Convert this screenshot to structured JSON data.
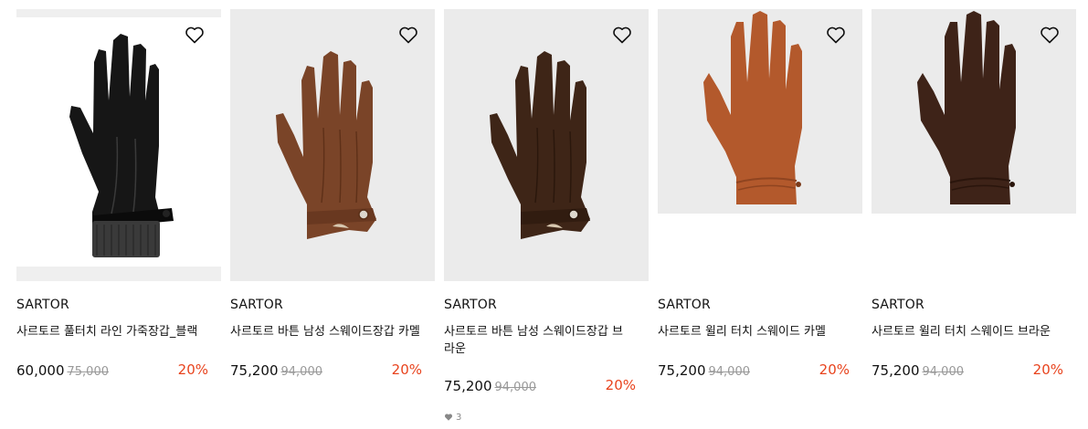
{
  "products": [
    {
      "brand": "SARTOR",
      "name": "사르토르 풀터치 라인 가죽장갑_블랙",
      "price": "60,000",
      "original_price": "75,000",
      "discount": "20%",
      "color": "#161616",
      "wishlist_icon": "heart-outline-icon"
    },
    {
      "brand": "SARTOR",
      "name": "사르토르 바튼 남성 스웨이드장갑 카멜",
      "price": "75,200",
      "original_price": "94,000",
      "discount": "20%",
      "color": "#7a4428",
      "wishlist_icon": "heart-outline-icon"
    },
    {
      "brand": "SARTOR",
      "name": "사르토르 바튼 남성 스웨이드장갑 브라운",
      "price": "75,200",
      "original_price": "94,000",
      "discount": "20%",
      "color": "#3e2517",
      "wishlist_icon": "heart-outline-icon",
      "likes": "3"
    },
    {
      "brand": "SARTOR",
      "name": "사르토르 윌리 터치 스웨이드 카멜",
      "price": "75,200",
      "original_price": "94,000",
      "discount": "20%",
      "color": "#b3592c",
      "wishlist_icon": "heart-outline-icon"
    },
    {
      "brand": "SARTOR",
      "name": "사르토르 윌리 터치 스웨이드 브라운",
      "price": "75,200",
      "original_price": "94,000",
      "discount": "20%",
      "color": "#3e2318",
      "wishlist_icon": "heart-outline-icon"
    }
  ],
  "colors": {
    "discount": "#e8431d",
    "image_bg": "#ebebeb"
  }
}
